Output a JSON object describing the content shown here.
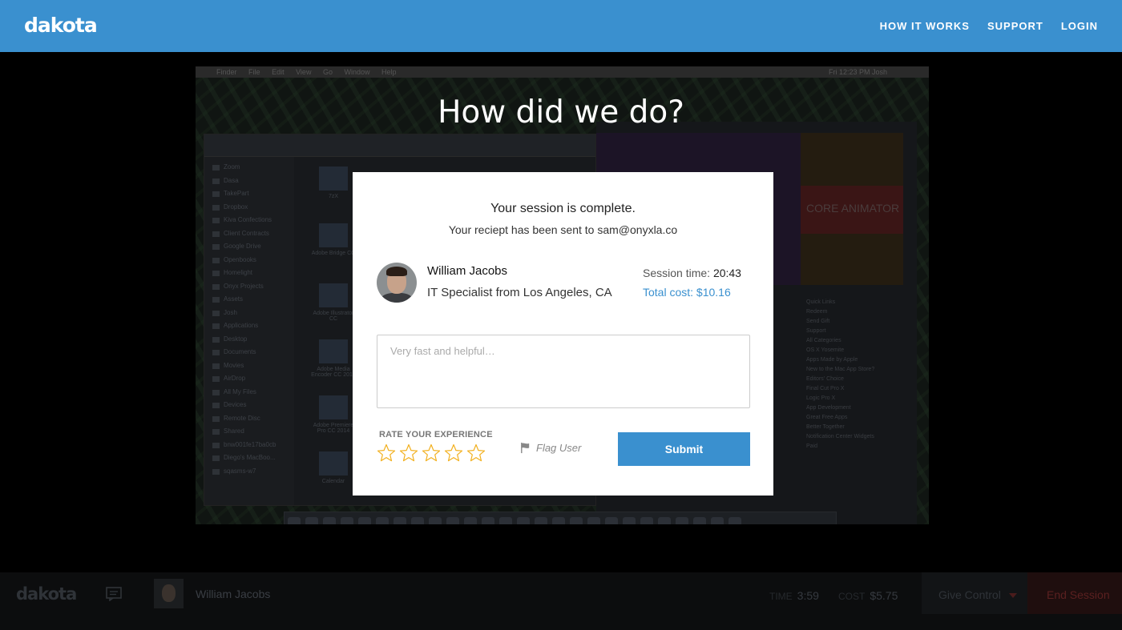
{
  "header": {
    "logo": "dakota",
    "nav": [
      "HOW IT WORKS",
      "SUPPORT",
      "LOGIN"
    ]
  },
  "headline": "How did we do?",
  "modal": {
    "title": "Your session is complete.",
    "subtitle": "Your reciept has been sent to sam@onyxla.co",
    "expert": {
      "name": "William Jacobs",
      "role": "IT Specialist from Los Angeles, CA"
    },
    "session_time_label": "Session time:",
    "session_time_value": "20:43",
    "total_cost_label": "Total cost:",
    "total_cost_value": "$10.16",
    "feedback_placeholder": "Very fast and helpful…",
    "feedback_value": "",
    "rate_label": "RATE YOUR EXPERIENCE",
    "rating": 0,
    "rating_max": 5,
    "flag_label": "Flag User",
    "submit_label": "Submit"
  },
  "bottom_bar": {
    "logo": "dakota",
    "expert_name": "William Jacobs",
    "time_label": "TIME",
    "time_value": "3:59",
    "cost_label": "COST",
    "cost_value": "$5.75",
    "give_control_label": "Give Control",
    "end_session_label": "End Session"
  },
  "remote_desktop": {
    "menubar": [
      "Finder",
      "File",
      "Edit",
      "View",
      "Go",
      "Window",
      "Help"
    ],
    "menubar_right": "Fri 12:23 PM   Josh",
    "sidebar": [
      "Zoom",
      "Dasa",
      "TakePart",
      "Dropbox",
      "Kiva Confections",
      "Client Contracts",
      "Google Drive",
      "Openbooks",
      "Homelight",
      "Onyx Projects",
      "Assets",
      "Josh",
      "Applications",
      "Desktop",
      "Documents",
      "Movies",
      "AirDrop",
      "All My Files",
      "Devices",
      "Remote Disc",
      "Shared",
      "bnw001fe17ba0cb",
      "Diego's MacBoo...",
      "sqasms-w7"
    ],
    "files": [
      "7zX",
      "Adobe Bridge CC",
      "Adobe Illustrator CC",
      "Adobe Media Encoder CC 2014",
      "Adobe Premiere Pro CC 2014",
      "Calendar"
    ],
    "banner": "CORE ANIMATOR",
    "quick_links": [
      "Quick Links",
      "Redeem",
      "Send Gift",
      "Support",
      "All Categories",
      "OS X Yosemite",
      "Apps Made by Apple",
      "New to the Mac App Store?",
      "Editors' Choice",
      "Final Cut Pro X",
      "Logic Pro X",
      "App Development",
      "Great Free Apps",
      "Better Together",
      "Notification Center Widgets",
      "Paid"
    ]
  },
  "colors": {
    "brand": "#3a90cf",
    "text_dark": "#222222"
  }
}
